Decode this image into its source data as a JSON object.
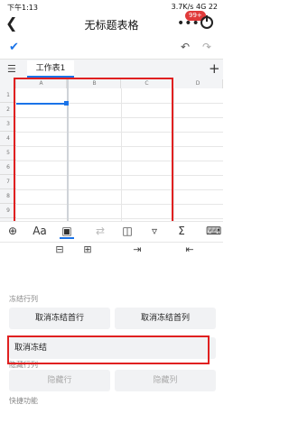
{
  "status_bar": {
    "time": "下午1:13",
    "right": "3.7K/s  4G  22"
  },
  "header": {
    "title": "无标题表格",
    "badge": "99+"
  },
  "sheet_tab": "工作表1",
  "columns": [
    "A",
    "B",
    "C",
    "D"
  ],
  "rows": [
    "1",
    "2",
    "3",
    "4",
    "5",
    "6",
    "7",
    "8",
    "9",
    "10"
  ],
  "freeze": {
    "section_title": "冻结行列",
    "unfreeze_first_row": "取消冻结首行",
    "unfreeze_first_col": "取消冻结首列",
    "unfreeze": "取消冻结"
  },
  "hide": {
    "section_title": "隐藏行列",
    "hide_row": "隐藏行",
    "hide_col": "隐藏列"
  },
  "quick": {
    "section_title": "快捷功能"
  }
}
